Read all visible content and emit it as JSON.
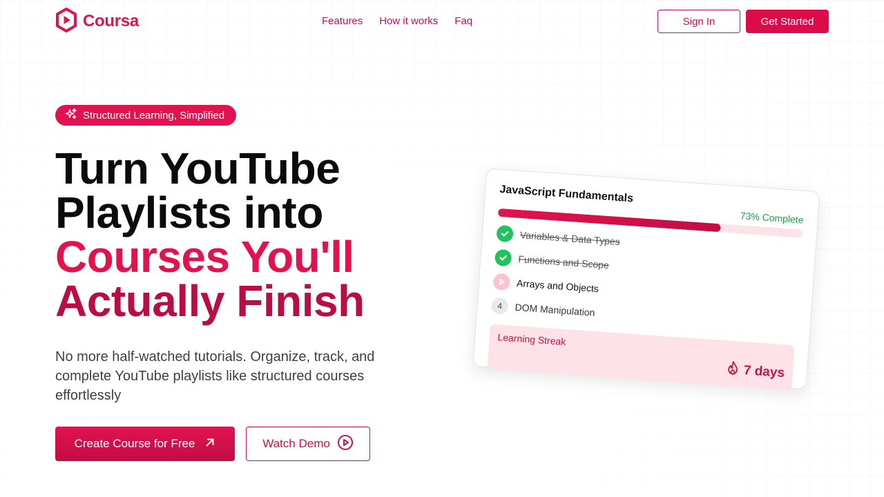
{
  "brand": {
    "name": "Coursa",
    "logo_icon": "hexagon-play-icon",
    "color": "#e0134f"
  },
  "nav": {
    "links": [
      "Features",
      "How it works",
      "Faq"
    ],
    "sign_in": "Sign In",
    "get_started": "Get Started"
  },
  "hero": {
    "badge": {
      "icon": "sparkles-icon",
      "text": "Structured Learning, Simplified"
    },
    "headline": {
      "line1": "Turn YouTube",
      "line2": "Playlists into",
      "line3": "Courses You'll",
      "line4": "Actually Finish"
    },
    "subtext": "No more half-watched tutorials. Organize, track, and complete YouTube playlists like structured courses effortlessly",
    "cta_primary": {
      "label": "Create Course for Free",
      "icon": "arrow-up-right-icon"
    },
    "cta_secondary": {
      "label": "Watch Demo",
      "icon": "play-circle-icon"
    }
  },
  "course_card": {
    "title": "JavaScript Fundamentals",
    "progress_label": "73% Complete",
    "progress": 0.73,
    "lessons": [
      {
        "label": "Variables & Data Types",
        "status": "done",
        "icon": "check-icon"
      },
      {
        "label": "Functions and Scope",
        "status": "done",
        "icon": "check-icon"
      },
      {
        "label": "Arrays and Objects",
        "status": "current",
        "icon": "play-icon"
      },
      {
        "label": "DOM Manipulation",
        "status": "pending",
        "number": "4"
      }
    ],
    "streak": {
      "label": "Learning Streak",
      "value": "7 days",
      "icon": "flame-icon"
    }
  },
  "colors": {
    "accent": "#e0134f",
    "accent_dark": "#b80e43",
    "success": "#1fc45c",
    "streak_bg": "#fde3e8"
  }
}
